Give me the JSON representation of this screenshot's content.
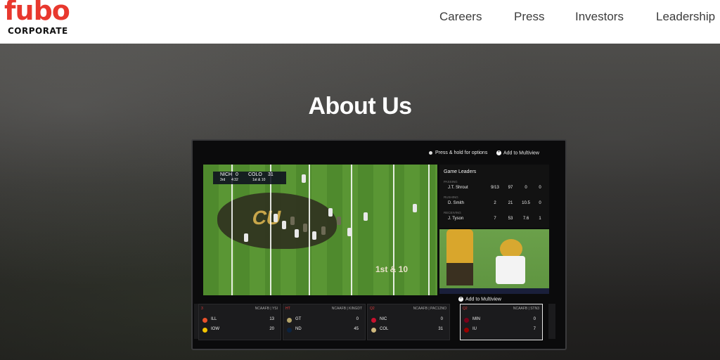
{
  "header": {
    "logo": {
      "word": "fubo",
      "sub": "CORPORATE"
    },
    "nav": [
      "Careers",
      "Press",
      "Investors",
      "Leadership"
    ]
  },
  "hero": {
    "title": "About Us"
  },
  "tv": {
    "hints": {
      "press_hold": "Press & hold for options",
      "add_multiview": "Add to Multiview"
    },
    "scorebug": {
      "team1": "NICH",
      "score1": "0",
      "team2": "COLO",
      "score2": "31",
      "quarter": "3rd",
      "clock": "4:32",
      "down": "1st & 10"
    },
    "field": {
      "endzone_text": "1st & 10"
    },
    "game_leaders": {
      "title": "Game Leaders",
      "rows": [
        {
          "category": "PASSING",
          "name": "J.T. Shrout",
          "vals": [
            "9/13",
            "97",
            "0",
            "0"
          ]
        },
        {
          "category": "RUSHING",
          "name": "D. Smith",
          "vals": [
            "2",
            "21",
            "10.5",
            "0"
          ]
        },
        {
          "category": "RECEIVING",
          "name": "J. Tyson",
          "vals": [
            "7",
            "53",
            "7.6",
            "1"
          ]
        }
      ]
    },
    "add_to_multiview": "Add to Multiview",
    "cards": [
      {
        "rank": "3",
        "meta": "NCAAFB | YSI",
        "teams": [
          {
            "name": "ILL",
            "score": "13",
            "color": "#e8502a"
          },
          {
            "name": "IOW",
            "score": "20",
            "color": "#f2c400"
          }
        ]
      },
      {
        "rank": "HT",
        "meta": "NCAAFB | KINGDT",
        "teams": [
          {
            "name": "GT",
            "score": "0",
            "color": "#b3a369"
          },
          {
            "name": "ND",
            "score": "45",
            "color": "#0c2340"
          }
        ]
      },
      {
        "rank": "Q2",
        "meta": "NCAAFB | PAC12NO",
        "teams": [
          {
            "name": "NIC",
            "score": "0",
            "color": "#c8102e"
          },
          {
            "name": "COL",
            "score": "31",
            "color": "#cfb87c"
          }
        ]
      },
      {
        "rank": "Q2",
        "meta": "NCAAFB | STN3",
        "teams": [
          {
            "name": "MIN",
            "score": "0",
            "color": "#7a0019"
          },
          {
            "name": "IU",
            "score": "7",
            "color": "#990000"
          }
        ]
      }
    ]
  },
  "colors": {
    "brand": "#e8382e",
    "nav_text": "#3c3c3c",
    "field_green": "#4f8a2d",
    "live_red": "#e23b3b"
  }
}
